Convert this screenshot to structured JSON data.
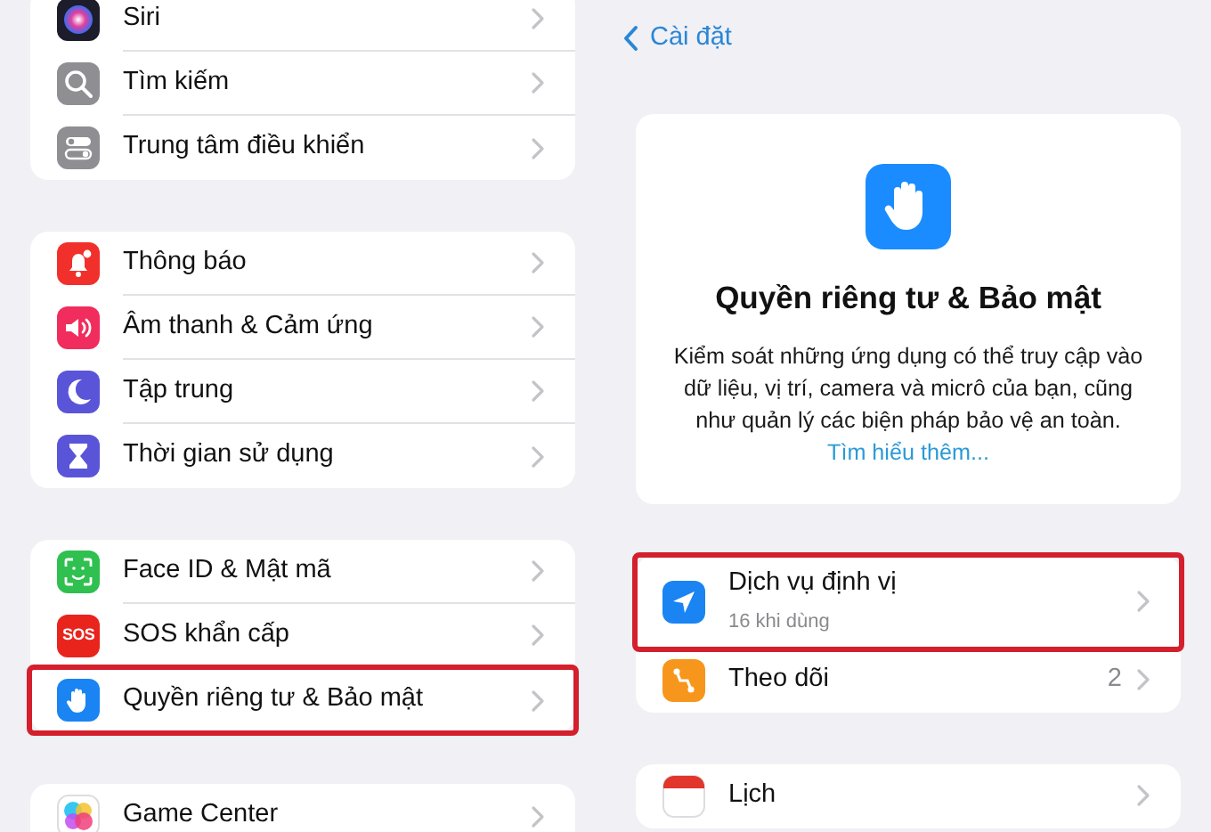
{
  "left_groups": [
    {
      "items": [
        {
          "label": "Siri",
          "kind": "siri",
          "highlighted": false
        },
        {
          "label": "Tìm kiếm",
          "kind": "search",
          "highlighted": false
        },
        {
          "label": "Trung tâm điều khiển",
          "kind": "toggles",
          "highlighted": false
        }
      ]
    },
    {
      "items": [
        {
          "label": "Thông báo",
          "kind": "bell",
          "highlighted": false
        },
        {
          "label": "Âm thanh & Cảm ứng",
          "kind": "speaker",
          "highlighted": false
        },
        {
          "label": "Tập trung",
          "kind": "moon",
          "highlighted": false
        },
        {
          "label": "Thời gian sử dụng",
          "kind": "hourglass",
          "highlighted": false
        }
      ]
    },
    {
      "items": [
        {
          "label": "Face ID & Mật mã",
          "kind": "faceid",
          "highlighted": false
        },
        {
          "label": "SOS khẩn cấp",
          "kind": "sos",
          "icon_text": "SOS",
          "highlighted": false
        },
        {
          "label": "Quyền riêng tư & Bảo mật",
          "kind": "hand",
          "highlighted": true
        }
      ]
    },
    {
      "items": [
        {
          "label": "Game Center",
          "kind": "gamecenter",
          "highlighted": false
        }
      ]
    }
  ],
  "back_button": {
    "label": "Cài đặt"
  },
  "header_card": {
    "title": "Quyền riêng tư & Bảo mật",
    "description": "Kiểm soát những ứng dụng có thể truy cập vào dữ liệu, vị trí, camera và micrô của bạn, cũng như quản lý các biện pháp bảo vệ an toàn.",
    "link": "Tìm hiểu thêm..."
  },
  "right_groups": [
    {
      "items": [
        {
          "label": "Dịch vụ định vị",
          "subtitle": "16 khi dùng",
          "kind": "location",
          "highlighted": true
        },
        {
          "label": "Theo dõi",
          "value": "2",
          "kind": "tracking",
          "highlighted": false
        }
      ]
    },
    {
      "items": [
        {
          "label": "Lịch",
          "kind": "calendar",
          "highlighted": false
        }
      ]
    }
  ]
}
